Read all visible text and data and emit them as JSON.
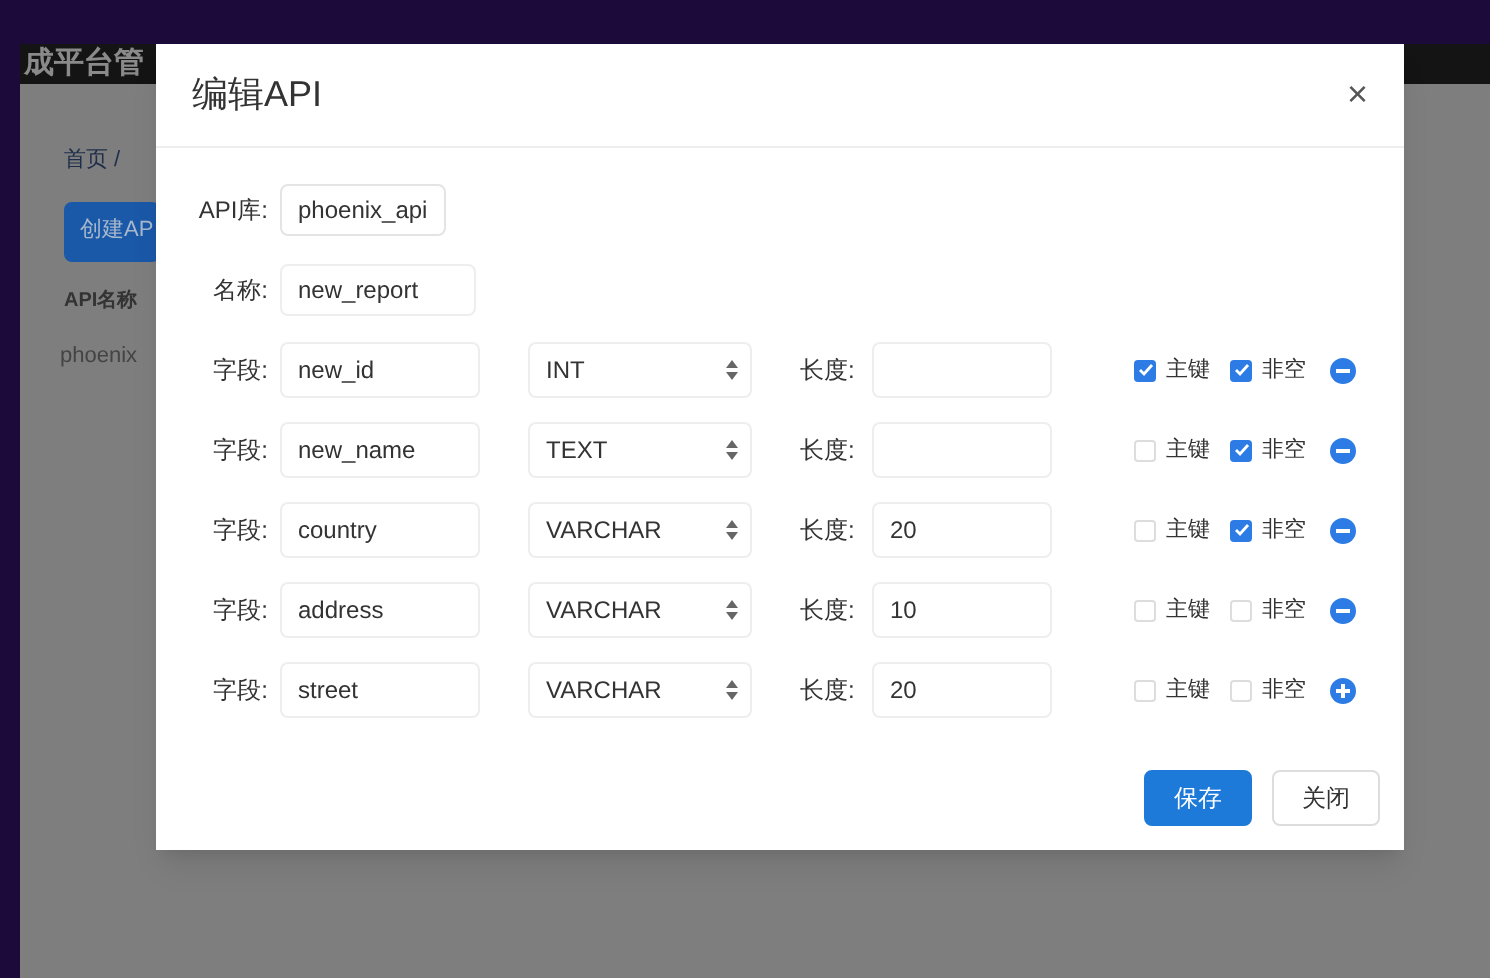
{
  "app_title": "成平台管",
  "background": {
    "breadcrumb": "首页 /",
    "create_button": "创建AP",
    "column_header": "API名称",
    "cell": "phoenix"
  },
  "dialog": {
    "title": "编辑API",
    "close": "×",
    "library": {
      "label": "API库:",
      "value": "phoenix_api"
    },
    "name": {
      "label": "名称:",
      "value": "new_report"
    },
    "fields": [
      {
        "label": "字段:",
        "name": "new_id",
        "type": "INT",
        "length_label": "长度:",
        "primary_label": "主键",
        "primary": true,
        "not_null_label": "非空",
        "not_null": true,
        "kind": "remove"
      },
      {
        "label": "字段:",
        "name": "new_name",
        "type": "TEXT",
        "length_label": "长度:",
        "primary_label": "主键",
        "primary": false,
        "not_null_label": "非空",
        "not_null": true,
        "kind": "remove"
      },
      {
        "label": "字段:",
        "name": "country",
        "type": "VARCHAR",
        "length_label": "长度:",
        "length": "20",
        "primary_label": "主键",
        "primary": false,
        "not_null_label": "非空",
        "not_null": true,
        "kind": "remove"
      },
      {
        "label": "字段:",
        "name": "address",
        "type": "VARCHAR",
        "length_label": "长度:",
        "length": "10",
        "primary_label": "主键",
        "primary": false,
        "not_null_label": "非空",
        "not_null": false,
        "kind": "remove"
      },
      {
        "label": "字段:",
        "name": "street",
        "type": "VARCHAR",
        "length_label": "长度:",
        "length": "20",
        "primary_label": "主键",
        "primary": false,
        "not_null_label": "非空",
        "not_null": false,
        "kind": "add"
      }
    ],
    "buttons": [
      {
        "label": "保存",
        "kind": "primary"
      },
      {
        "label": "关闭",
        "kind": "default"
      }
    ]
  }
}
